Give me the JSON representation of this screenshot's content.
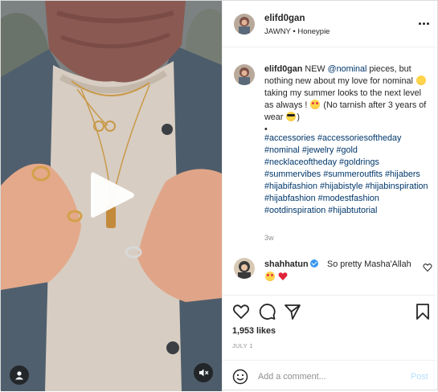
{
  "header": {
    "username": "elifd0gan",
    "audio": "JAWNY • Honeypie"
  },
  "caption": {
    "username": "elifd0gan",
    "text_before_mention": "NEW ",
    "mention": "@nominal",
    "text_after_mention": " pieces, but nothing new about my love for nominal ",
    "text_mid": " taking my summer looks to the next level as always ! ",
    "text_end": " (No tarnish after 3 years of wear ",
    "text_tail": ")",
    "bullet": "•",
    "hashtags": [
      "#accessories",
      "#accessoriesoftheday",
      "#nominal",
      "#jewelry",
      "#gold",
      "#necklaceoftheday",
      "#goldrings",
      "#summervibes",
      "#summeroutfits",
      "#hijabers",
      "#hijabifashion",
      "#hijabistyle",
      "#hijabinspiration",
      "#hijabfashion",
      "#modestfashion",
      "#ootdinspiration",
      "#hijabtutorial"
    ],
    "time": "3w"
  },
  "comment": {
    "username": "shahhatun",
    "text": "So pretty Masha'Allah"
  },
  "actions": {
    "likes": "1,953 likes",
    "date": "JULY 1"
  },
  "add_comment": {
    "placeholder": "Add a comment...",
    "post_label": "Post"
  },
  "icons": {
    "play": "play-icon",
    "user_tag": "user-icon",
    "mute": "speaker-muted-icon",
    "more": "more-horizontal-icon",
    "like": "heart-outline-icon",
    "comment": "comment-bubble-icon",
    "share": "paper-plane-icon",
    "save": "bookmark-icon",
    "emoji": "smiley-icon"
  },
  "colors": {
    "link": "#00376b",
    "muted": "#8e8e8e",
    "post_button": "#b2dffc",
    "verified": "#3897f0"
  }
}
